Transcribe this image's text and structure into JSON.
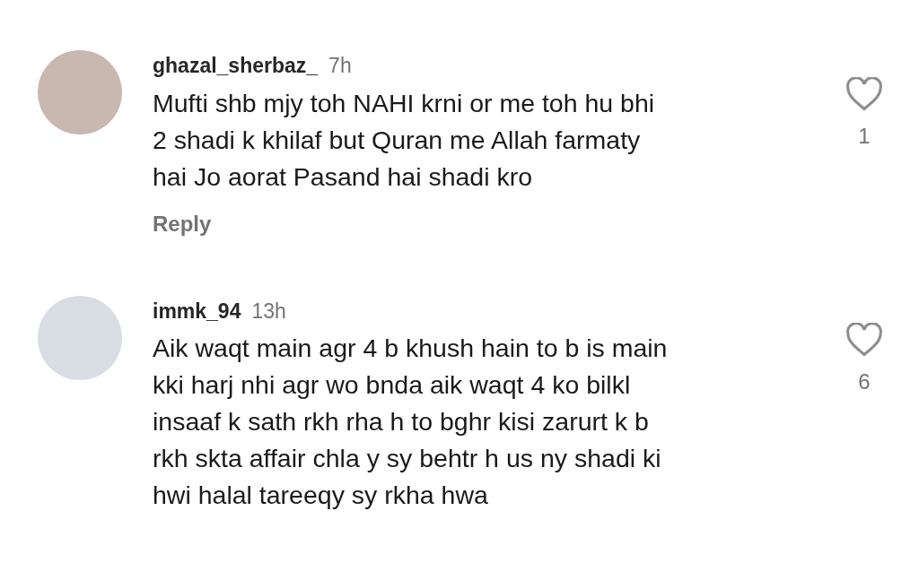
{
  "comments": [
    {
      "username": "ghazal_sherbaz_",
      "time": "7h",
      "lines": [
        "Mufti shb mjy toh NAHI krni or me toh hu bhi",
        "2 shadi k khilaf  but Quran me Allah farmaty",
        "hai Jo aorat Pasand hai shadi kro"
      ],
      "reply": "Reply",
      "likes": "1",
      "liked": false
    },
    {
      "username": "immk_94",
      "time": "13h",
      "lines": [
        "Aik waqt main agr 4 b khush hain to b is main",
        "kki harj nhi agr wo bnda aik waqt 4 ko bilkl",
        "insaaf k sath rkh rha h to bghr kisi zarurt k b",
        "rkh skta affair chla y sy behtr h us ny shadi ki",
        "hwi halal tareeqy sy rkha hwa"
      ],
      "likes": "6",
      "liked": false
    }
  ]
}
